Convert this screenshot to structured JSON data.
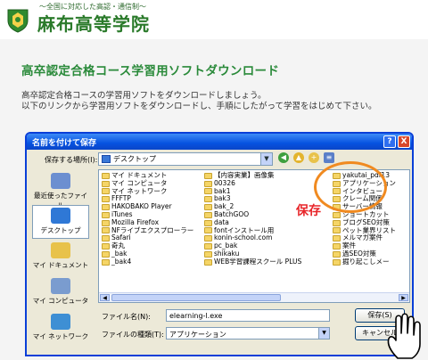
{
  "header": {
    "tagline": "～全国に対応した高認・通信制～",
    "school_name": "麻布高等学院"
  },
  "page": {
    "title": "高卒認定合格コース学習用ソフトダウンロード",
    "intro_line1": "高卒認定合格コースの学習用ソフトをダウンロードしましょう。",
    "intro_line2": "以下のリンクから学習用ソフトをダウンロードし、手順にしたがって学習をはじめて下さい。"
  },
  "dialog": {
    "title": "名前を付けて保存",
    "help_label": "?",
    "close_label": "X",
    "save_in_label": "保存する場所(I):",
    "save_in_value": "デスクトップ",
    "places": [
      {
        "label": "最近使ったファイル",
        "color": "#6c8fd0"
      },
      {
        "label": "デスクトップ",
        "color": "#2f78d6"
      },
      {
        "label": "マイ ドキュメント",
        "color": "#e8c24a"
      },
      {
        "label": "マイ コンピュータ",
        "color": "#7a9ccf"
      },
      {
        "label": "マイ ネットワーク",
        "color": "#3e8fd4"
      }
    ],
    "files_col1": [
      "マイ ドキュメント",
      "マイ コンピュータ",
      "マイ ネットワーク",
      "FFFTP",
      "HAKOBAKO Player",
      "iTunes",
      "Mozilla Firefox",
      "NFライブエクスプローラー",
      "Safari",
      "奇丸",
      "_bak",
      "_bak4"
    ],
    "files_col2": [
      "【内容実業】画像集",
      "00326",
      "bak1",
      "bak3",
      "bak_2",
      "BatchGOO",
      "data",
      "fontインストール用",
      "konin-school.com",
      "pc_bak",
      "shikaku",
      "WEB学習課程スクール PLUS"
    ],
    "files_col3": [
      "yakutai_pdf13",
      "アプリケーション",
      "インタビュー",
      "クレーム関係",
      "サーバー情報",
      "ショートカット",
      "ブログSEO対策",
      "ペット業界リスト",
      "メルマガ案件",
      "案件",
      "過SEO対策",
      "掘り起こしメー"
    ],
    "filename_label": "ファイル名(N):",
    "filename_value": "elearning-l.exe",
    "filetype_label": "ファイルの種類(T):",
    "filetype_value": "アプリケーション",
    "save_button": "保存(S)",
    "cancel_button": "キャンセル"
  },
  "annotation": {
    "callout": "保存"
  }
}
